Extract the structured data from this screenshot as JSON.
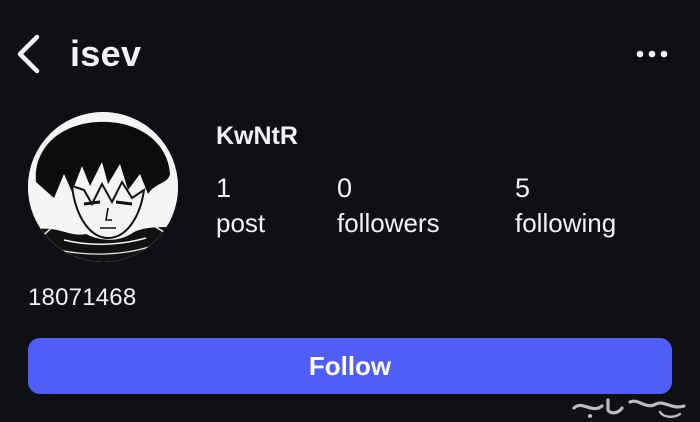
{
  "header": {
    "title": "isev",
    "back_icon": "chevron-left-icon",
    "more_icon": "more-horizontal-icon"
  },
  "profile": {
    "display_name": "KwNtR",
    "bio": "18071468",
    "avatar_icon": "profile-avatar"
  },
  "stats": {
    "posts": {
      "value": "1",
      "label": "post"
    },
    "followers": {
      "value": "0",
      "label": "followers"
    },
    "following": {
      "value": "5",
      "label": "following"
    }
  },
  "actions": {
    "follow_label": "Follow"
  },
  "watermark": {
    "text": "حراج"
  },
  "colors": {
    "background": "#0e1016",
    "text": "#f2f3f5",
    "follow_button": "#4f5ef7"
  }
}
